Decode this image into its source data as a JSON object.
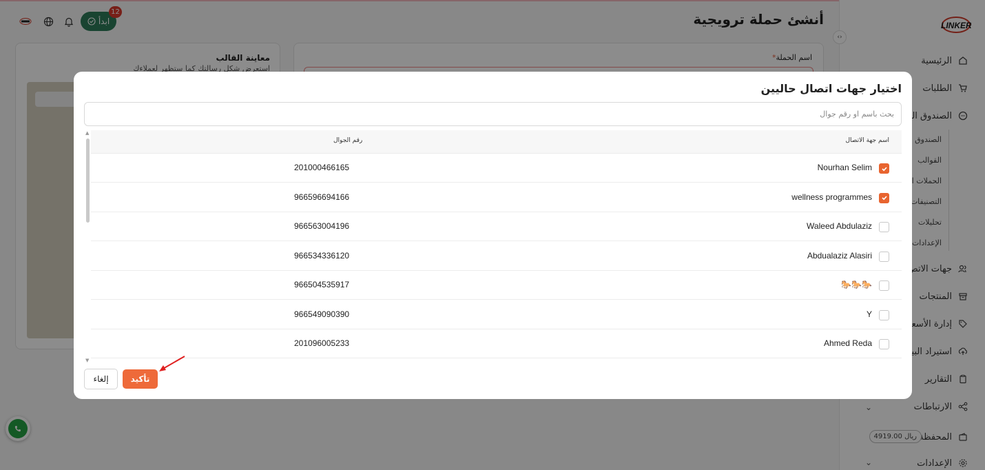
{
  "page": {
    "title": "أنشئ حملة ترويجية",
    "start_label": "ابدأ",
    "notification_count": "12"
  },
  "sidebar": {
    "logo": "LINKER",
    "items": [
      {
        "label": "الرئيسية",
        "icon": "home-icon"
      },
      {
        "label": "الطلبات",
        "icon": "cart-icon"
      },
      {
        "label": "الصندوق الو",
        "icon": "chat-icon"
      },
      {
        "label": "جهات الاتص",
        "icon": "users-icon"
      },
      {
        "label": "المنتجات",
        "icon": "box-icon"
      },
      {
        "label": "إدارة الأسعا",
        "icon": "tag-icon"
      },
      {
        "label": "استيراد البيا",
        "icon": "upload-icon"
      },
      {
        "label": "التقارير",
        "icon": "clipboard-icon"
      },
      {
        "label": "الارتباطات",
        "icon": "share-icon"
      },
      {
        "label": "المحفظة",
        "icon": "wallet-icon"
      },
      {
        "label": "الإعدادات",
        "icon": "gear-icon"
      }
    ],
    "subitems": [
      "الصندوق ا",
      "القوالب",
      "الحملات ا",
      "التصنيفات",
      "تحليلات",
      "الإعدادات"
    ],
    "wallet_balance": "4919.00 ريال"
  },
  "preview": {
    "title": "معاينة القالب",
    "subtitle": "استعرض شكل رسالتك كما ستظهر لعملاءك"
  },
  "form": {
    "campaign_name_label": "اسم الحملة"
  },
  "modal": {
    "title": "اختيار جهات اتصال حاليين",
    "search_placeholder": "بحث باسم او رقم جوال",
    "col_name": "اسم جهة الاتصال",
    "col_phone": "رقم الجوال",
    "confirm_label": "تأكيد",
    "cancel_label": "إلغاء",
    "rows": [
      {
        "name": "Nourhan Selim",
        "phone": "201000466165",
        "checked": true
      },
      {
        "name": "wellness programmes",
        "phone": "966596694166",
        "checked": true
      },
      {
        "name": "Waleed Abdulaziz",
        "phone": "966563004196",
        "checked": false
      },
      {
        "name": "Abdualaziz Alasiri",
        "phone": "966534336120",
        "checked": false
      },
      {
        "name": "🐎🐎🐎",
        "phone": "966504535917",
        "checked": false
      },
      {
        "name": "Y",
        "phone": "966549090390",
        "checked": false
      },
      {
        "name": "Ahmed Reda",
        "phone": "201096005233",
        "checked": false
      }
    ]
  },
  "colors": {
    "accent": "#ee6a3a",
    "brand_green": "#2e7d5a",
    "badge_red": "#d93a2c"
  }
}
